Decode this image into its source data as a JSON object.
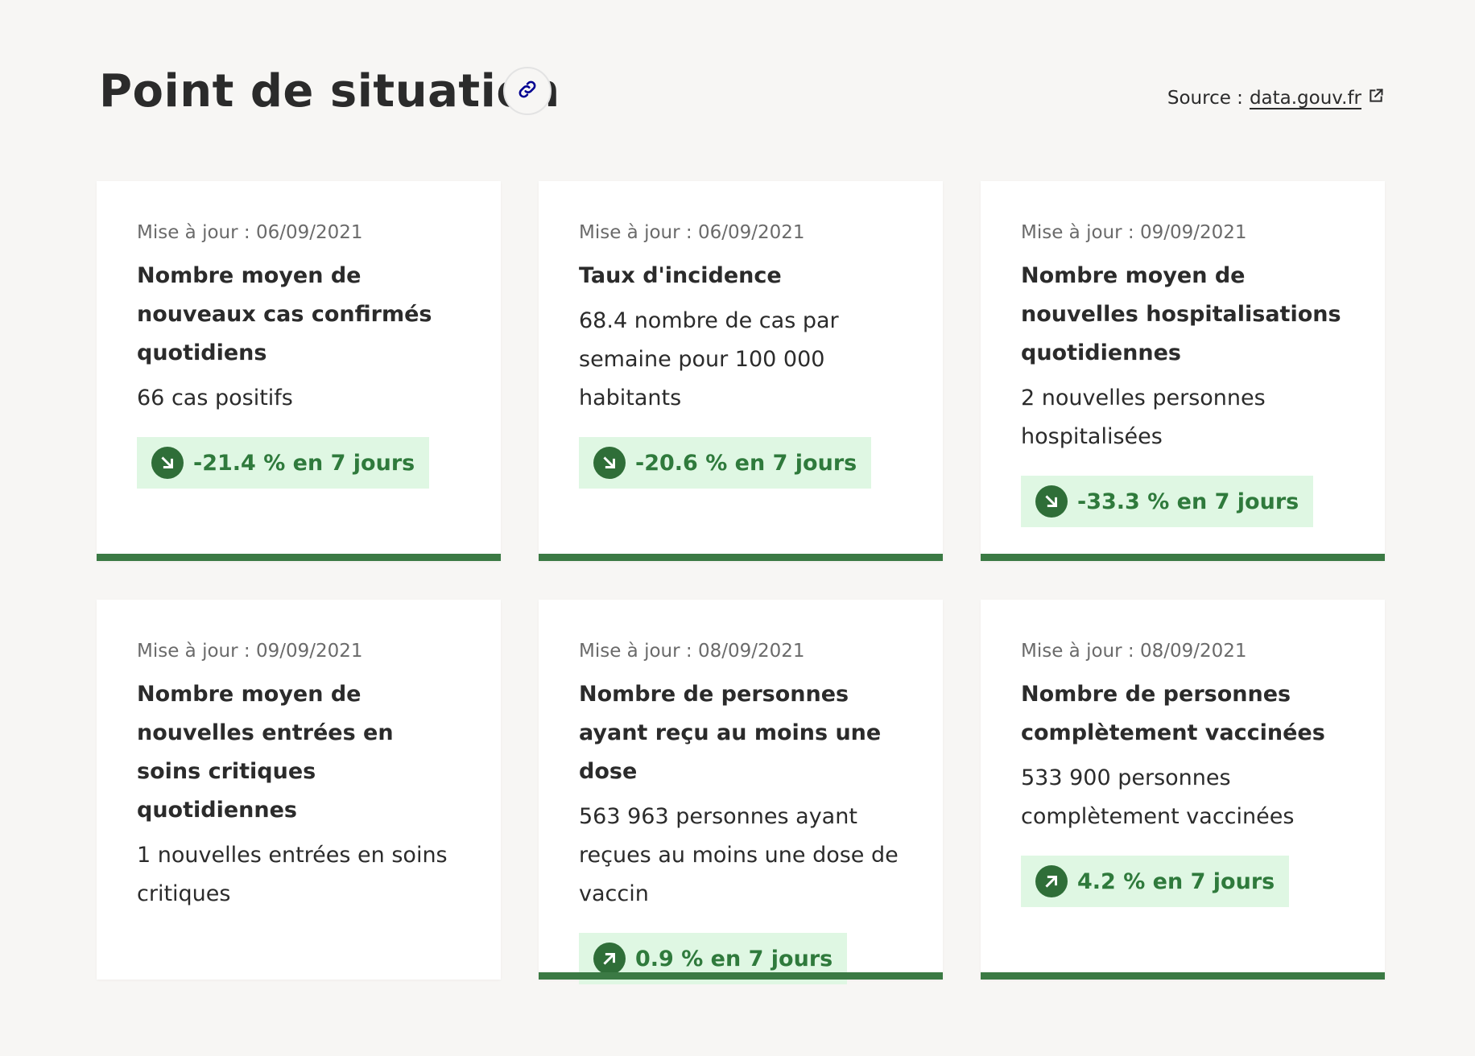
{
  "header": {
    "title": "Point de situation",
    "source_label": "Source :",
    "source_link": "data.gouv.fr"
  },
  "colors": {
    "background": "#f7f6f4",
    "card": "#ffffff",
    "accent_green": "#3b7a44",
    "badge_bg": "#dff7e3",
    "badge_text": "#2f7a3c",
    "anchor_icon": "#000091"
  },
  "cards": [
    {
      "update": "Mise à jour : 06/09/2021",
      "title": "Nombre moyen de nouveaux cas confirmés quotidiens",
      "value": "66 cas positifs",
      "trend": "-21.4 % en 7 jours",
      "trend_icon": "arrow-down-right-icon"
    },
    {
      "update": "Mise à jour : 06/09/2021",
      "title": "Taux d'incidence",
      "value": "68.4 nombre de cas par semaine pour 100 000 habitants",
      "trend": "-20.6 % en 7 jours",
      "trend_icon": "arrow-down-right-icon"
    },
    {
      "update": "Mise à jour : 09/09/2021",
      "title": "Nombre moyen de nouvelles hospitalisations quotidiennes",
      "value": "2 nouvelles personnes hospitalisées",
      "trend": "-33.3 % en 7 jours",
      "trend_icon": "arrow-down-right-icon"
    },
    {
      "update": "Mise à jour : 09/09/2021",
      "title": "Nombre moyen de nouvelles entrées en soins critiques quotidiennes",
      "value": "1 nouvelles entrées en soins critiques"
    },
    {
      "update": "Mise à jour : 08/09/2021",
      "title": "Nombre de personnes ayant reçu au moins une dose",
      "value": "563 963 personnes ayant reçues au moins une dose de vaccin",
      "trend": "0.9 % en 7 jours",
      "trend_icon": "arrow-up-right-icon"
    },
    {
      "update": "Mise à jour : 08/09/2021",
      "title": "Nombre de personnes complètement vaccinées",
      "value": "533 900 personnes complètement vaccinées",
      "trend": "4.2 % en 7 jours",
      "trend_icon": "arrow-up-right-icon"
    }
  ]
}
